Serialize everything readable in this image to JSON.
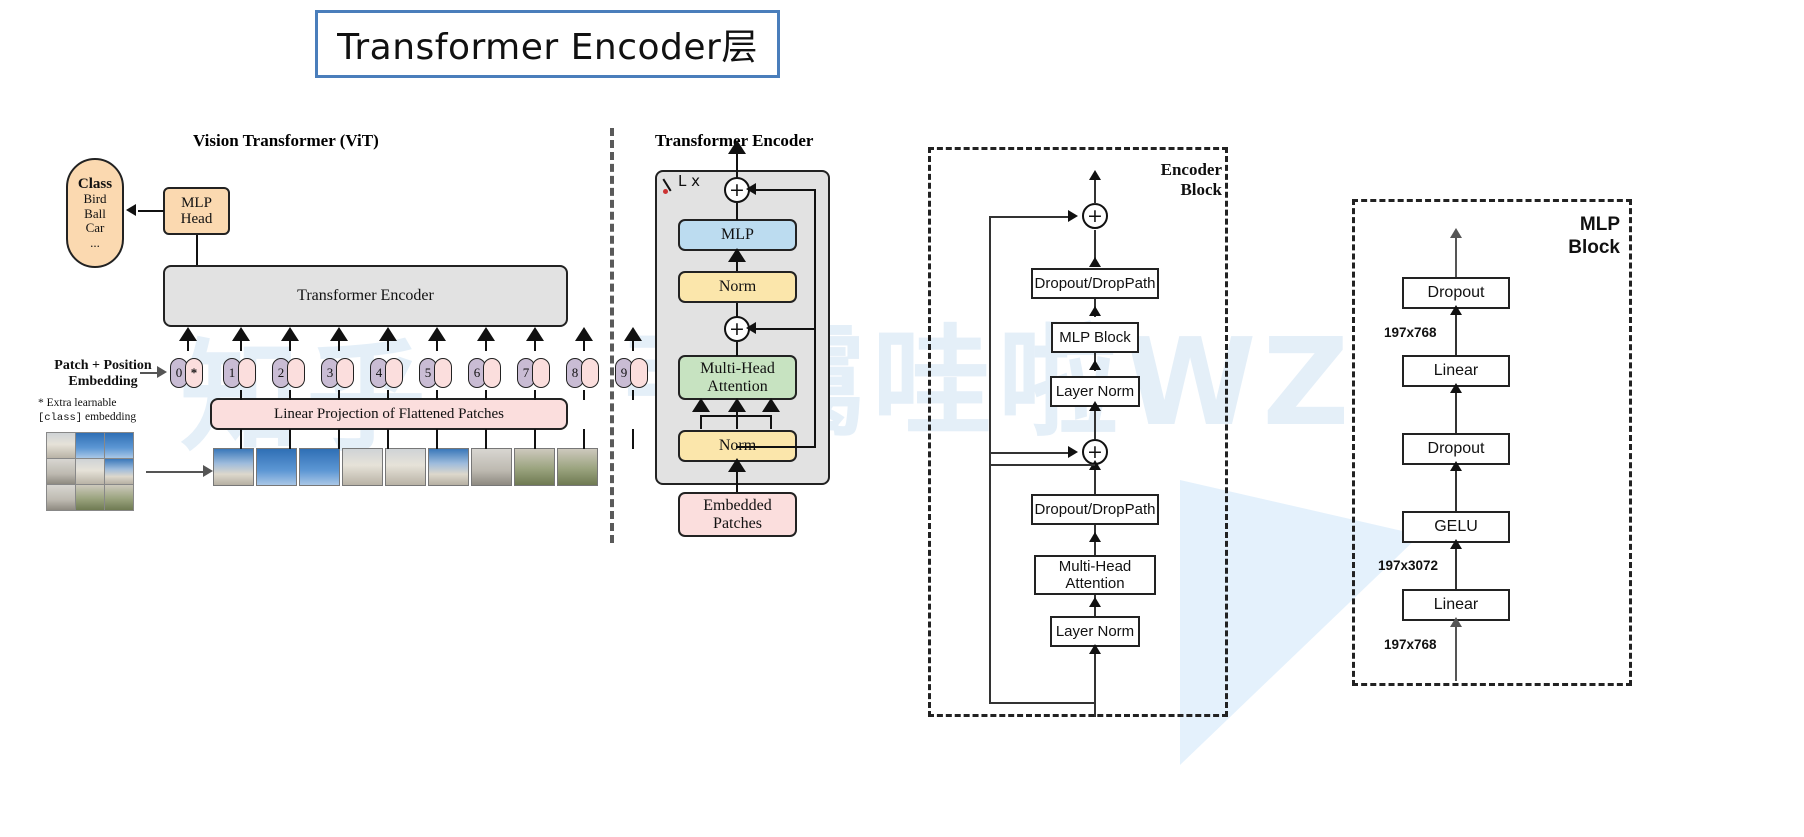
{
  "title": {
    "text": "Transformer Encoder层",
    "border_color": "#4a7ebb"
  },
  "watermark": {
    "line1": "知乎",
    "line2": "韦霭哇啦WZ"
  },
  "vit": {
    "heading": "Vision Transformer (ViT)",
    "class_pill": {
      "title": "Class",
      "items": [
        "Bird",
        "Ball",
        "Car",
        "..."
      ],
      "fill": "#fbd9b0"
    },
    "mlp_head": {
      "line1": "MLP",
      "line2": "Head",
      "fill": "#fbd9b0"
    },
    "encoder": {
      "label": "Transformer Encoder",
      "fill": "#e2e2e2"
    },
    "embedding_label": {
      "line1": "Patch + Position",
      "line2": "Embedding"
    },
    "extra_note": {
      "line1": "* Extra learnable",
      "mono": "[class]",
      "tail": " embedding"
    },
    "tokens": [
      {
        "num": "0",
        "patch": "*"
      },
      {
        "num": "1",
        "patch": ""
      },
      {
        "num": "2",
        "patch": ""
      },
      {
        "num": "3",
        "patch": ""
      },
      {
        "num": "4",
        "patch": ""
      },
      {
        "num": "5",
        "patch": ""
      },
      {
        "num": "6",
        "patch": ""
      },
      {
        "num": "7",
        "patch": ""
      },
      {
        "num": "8",
        "patch": ""
      },
      {
        "num": "9",
        "patch": ""
      }
    ],
    "linear_projection": {
      "label": "Linear Projection of Flattened Patches",
      "fill": "#fbdedd"
    },
    "token_colors": {
      "position": "#c9bcd4",
      "patch": "#fbdedd"
    }
  },
  "transformer_encoder": {
    "heading": "Transformer Encoder",
    "repeat_label": "L x",
    "blocks": [
      {
        "label": "MLP",
        "fill": "#bcdcf0"
      },
      {
        "label": "Norm",
        "fill": "#fbe6ab"
      },
      {
        "label": "Multi-Head\nAttention",
        "line1": "Multi-Head",
        "line2": "Attention",
        "fill": "#c7e3c1"
      },
      {
        "label": "Norm",
        "fill": "#fbe6ab"
      },
      {
        "label": "Embedded Patches",
        "line1": "Embedded",
        "line2": "Patches",
        "fill": "#fbdedd"
      }
    ],
    "add_symbol": "+"
  },
  "encoder_block": {
    "title_line1": "Encoder",
    "title_line2": "Block",
    "add_symbol": "+",
    "blocks": [
      {
        "label": "Dropout/DropPath"
      },
      {
        "label": "MLP Block"
      },
      {
        "label": "Layer Norm"
      },
      {
        "label": "Dropout/DropPath"
      },
      {
        "line1": "Multi-Head",
        "line2": "Attention"
      },
      {
        "label": "Layer Norm"
      }
    ]
  },
  "mlp_block": {
    "title_line1": "MLP",
    "title_line2": "Block",
    "blocks": [
      {
        "label": "Dropout"
      },
      {
        "label": "Linear"
      },
      {
        "label": "Dropout"
      },
      {
        "label": "GELU"
      },
      {
        "label": "Linear"
      }
    ],
    "dims": [
      "197x768",
      "197x3072",
      "197x768"
    ]
  }
}
